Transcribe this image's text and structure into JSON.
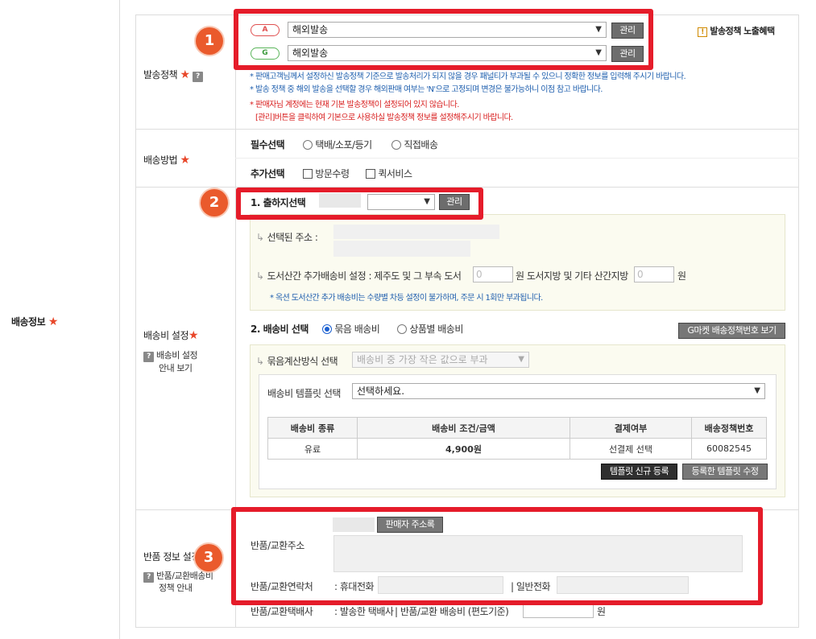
{
  "left": {
    "section_label": "배송정보"
  },
  "policy": {
    "label": "발송정책",
    "help": "?",
    "rows": [
      {
        "badge": "A",
        "value": "해외발송",
        "button": "관리"
      },
      {
        "badge": "G",
        "value": "해외발송",
        "button": "관리"
      }
    ],
    "expose_link": "발송정책 노출혜택",
    "expose_icon": "!",
    "notes_blue": [
      "* 판매고객님께서 설정하신 발송정책 기준으로 발송처리가 되지 않을 경우 패널티가 부과될 수 있으니 정확한 정보를 입력해 주시기 바랍니다.",
      "* 발송 정책 중 해외 발송을 선택할 경우 해외판매 여부는 'N'으로 고정되며 변경은 불가능하니 이점 참고 바랍니다."
    ],
    "notes_red": [
      "* 판매자님 계정에는 현재 기본 발송정책이 설정되어 있지 않습니다.",
      "[관리]버튼을 클릭하여 기본으로 사용하실 발송정책 정보를 설정해주시기 바랍니다."
    ]
  },
  "method": {
    "label": "배송방법",
    "required_label": "필수선택",
    "required_options": [
      "택배/소포/등기",
      "직접배송"
    ],
    "extra_label": "추가선택",
    "extra_options": [
      "방문수령",
      "퀵서비스"
    ]
  },
  "fee": {
    "label": "배송비 설정",
    "help_text_1": "배송비 설정",
    "help_text_2": "안내 보기",
    "origin_title": "1. 출하지선택",
    "origin_button": "관리",
    "selected_address_label": "선택된 주소 :",
    "island_label": "도서산간 추가배송비 설정 : 제주도 및 그 부속 도서",
    "island_value_1": "0",
    "island_unit_1": "원 도서지방 및 기타 산간지방",
    "island_value_2": "0",
    "island_unit_2": "원",
    "island_note": "* 옥션 도서산간 추가 배송비는 수량별 차등 설정이 불가하며, 주문 시 1회만 부과됩니다.",
    "select_title": "2. 배송비 선택",
    "select_options": [
      "묶음 배송비",
      "상품별 배송비"
    ],
    "gmarket_button": "G마켓 배송정책번호 보기",
    "bundle_label": "묶음계산방식 선택",
    "bundle_value": "배송비 중 가장 작은 값으로 부과",
    "template_label": "배송비 템플릿 선택",
    "template_value": "선택하세요.",
    "table_headers": [
      "배송비 종류",
      "배송비 조건/금액",
      "결제여부",
      "배송정책번호"
    ],
    "table_row": [
      "유료",
      "4,900원",
      "선결제 선택",
      "60082545"
    ],
    "new_template_button": "템플릿 신규 등록",
    "edit_template_button": "등록한 템플릿 수정"
  },
  "return": {
    "label": "반품 정보 설정",
    "help_text_1": "반품/교환배송비",
    "help_text_2": "정책 안내",
    "seller_addr_button": "판매자 주소록",
    "addr_label": "반품/교환주소",
    "contact_label": "반품/교환연락처",
    "mobile_label": ": 휴대전화",
    "phone_label": "| 일반전화",
    "courier_label": "반품/교환택배사",
    "courier_value": ": 발송한 택배사",
    "return_fee_label": "반품/교환 배송비 (편도기준)",
    "return_fee_unit": "원"
  },
  "callouts": [
    "1",
    "2",
    "3"
  ],
  "colors": {
    "accent_red": "#e51c2a",
    "badge_orange": "#ea5a2c",
    "note_blue": "#1f5fae",
    "note_red": "#d81e1e"
  }
}
